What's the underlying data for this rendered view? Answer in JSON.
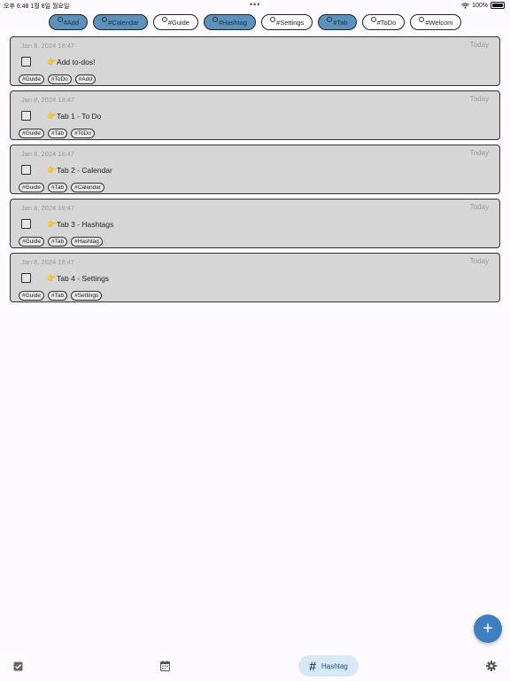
{
  "status_bar": {
    "time_date": "오후 6:48  1월 8일 월요일",
    "dots": "•••",
    "battery_text": "100%"
  },
  "chips": [
    {
      "label": "#Add",
      "selected": true
    },
    {
      "label": "#Calendar",
      "selected": true
    },
    {
      "label": "#Guide",
      "selected": false
    },
    {
      "label": "#Hashtag",
      "selected": true
    },
    {
      "label": "#Settings",
      "selected": false
    },
    {
      "label": "#Tab",
      "selected": true
    },
    {
      "label": "#ToDo",
      "selected": false
    },
    {
      "label": "#Welcom",
      "selected": false
    }
  ],
  "todos": [
    {
      "date": "Jan 8, 2024 18:47",
      "today": "Today",
      "emoji": "👉",
      "title": "Add to-dos!",
      "tags": [
        "#Guide",
        "#ToDo",
        "#Add"
      ]
    },
    {
      "date": "Jan 8, 2024 18:47",
      "today": "Today",
      "emoji": "👉",
      "title": "Tab 1 - To Do",
      "tags": [
        "#Guide",
        "#Tab",
        "#ToDo"
      ]
    },
    {
      "date": "Jan 8, 2024 18:47",
      "today": "Today",
      "emoji": "👉",
      "title": "Tab 2 - Calendar",
      "tags": [
        "#Guide",
        "#Tab",
        "#Calendar"
      ]
    },
    {
      "date": "Jan 8, 2024 18:47",
      "today": "Today",
      "emoji": "👉",
      "title": "Tab 3 - Hashtags",
      "tags": [
        "#Guide",
        "#Tab",
        "#Hashtag"
      ]
    },
    {
      "date": "Jan 8, 2024 18:47",
      "today": "Today",
      "emoji": "👉",
      "title": "Tab 4 - Settings",
      "tags": [
        "#Guide",
        "#Tab",
        "#Settings"
      ]
    }
  ],
  "fab": {
    "icon": "plus-icon",
    "glyph": "+"
  },
  "bottom_nav": {
    "todo_icon": "checkbox-icon",
    "calendar_icon": "calendar-icon",
    "hashtag_glyph": "#",
    "hashtag_label": "Hashtag",
    "settings_icon": "gear-icon"
  },
  "colors": {
    "chip_selected": "#5b92bd",
    "card_bg": "#d6d6d6",
    "fab": "#3f7fbf",
    "nav_active_bg": "#d9e8f5"
  }
}
